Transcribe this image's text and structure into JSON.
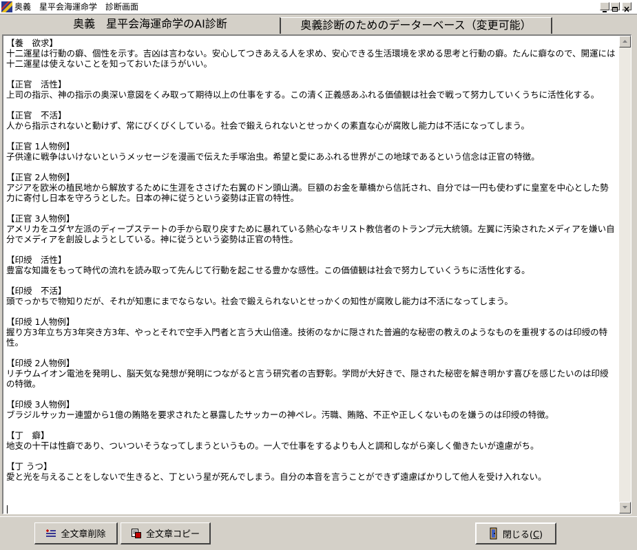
{
  "window": {
    "title": "奥義　星平会海運命学　診断画面"
  },
  "tabs": [
    {
      "label": "奥義　星平会海運命学のAI診断",
      "active": true
    },
    {
      "label": "奥義診断のためのデーターベース（変更可能）",
      "active": false
    }
  ],
  "entries": [
    {
      "head": "【養　欲求】",
      "body": "十二運星は行動の癖、個性を示す。吉凶は言わない。安心してつきあえる人を求め、安心できる生活環境を求める思考と行動の癖。たんに癖なので、開運には十二運星は使えないことを知っておいたほうがいい。"
    },
    {
      "head": "【正官　活性】",
      "body": "上司の指示、神の指示の奥深い意図をくみ取って期待以上の仕事をする。この清く正義感あふれる価値観は社会で戦って努力していくうちに活性化する。"
    },
    {
      "head": "【正官　不活】",
      "body": "人から指示されないと動けず、常にびくびくしている。社会で鍛えられないとせっかくの素直な心が腐敗し能力は不活になってしまう。"
    },
    {
      "head": "【正官 1人物例】",
      "body": "子供達に戦争はいけないというメッセージを漫画で伝えた手塚治虫。希望と愛にあふれる世界がこの地球であるという信念は正官の特徴。"
    },
    {
      "head": "【正官 2人物例】",
      "body": "アジアを欧米の植民地から解放するために生涯をささげた右翼のドン頭山満。巨額のお金を華橋から信託され、自分では一円も使わずに皇室を中心とした勢力に寄付し日本を守ろうとした。日本の神に従うという姿勢は正官の特性。"
    },
    {
      "head": "【正官 3人物例】",
      "body": "アメリカをユダヤ左派のディープステートの手から取り戻すために暴れている熱心なキリスト教信者のトランプ元大統領。左翼に汚染されたメディアを嫌い自分でメディアを創設しようとしている。神に従うという姿勢は正官の特性。"
    },
    {
      "head": "【印綬　活性】",
      "body": "豊富な知識をもって時代の流れを読み取って先んじて行動を起こせる豊かな感性。この価値観は社会で努力していくうちに活性化する。"
    },
    {
      "head": "【印綬　不活】",
      "body": "頭でっかちで物知りだが、それが知恵にまでならない。社会で鍛えられないとせっかくの知性が腐敗し能力は不活になってしまう。"
    },
    {
      "head": "【印綬 1人物例】",
      "body": "握り方3年立ち方3年突き方3年、やっとそれで空手入門者と言う大山倍達。技術のなかに隠された普遍的な秘密の教えのようなものを重視するのは印綬の特性。"
    },
    {
      "head": "【印綬 2人物例】",
      "body": "リチウムイオン電池を発明し、脳天気な発想が発明につながると言う研究者の吉野彰。学問が大好きで、隠された秘密を解き明かす喜びを感じたいのは印綬の特徴。"
    },
    {
      "head": "【印綬 3人物例】",
      "body": "ブラジルサッカー連盟から1億の賄賂を要求されたと暴露したサッカーの神ペレ。汚職、賄賂、不正や正しくないものを嫌うのは印綬の特徴。"
    },
    {
      "head": "【丁　癖】",
      "body": "地支の十干は性癖であり、ついついそうなってしまうというもの。一人で仕事をするよりも人と調和しながら楽しく働きたいが遠慮がち。"
    },
    {
      "head": "【丁 うつ】",
      "body": "愛と光を与えることをしないで生きると、丁という星が死んでしまう。自分の本音を言うことができず遠慮ばかりして他人を受け入れない。"
    }
  ],
  "buttons": {
    "delete_label": "全文章削除",
    "copy_label": "全文章コピー",
    "close_label_pre": "閉じる(",
    "close_key": "C",
    "close_label_post": ")"
  }
}
